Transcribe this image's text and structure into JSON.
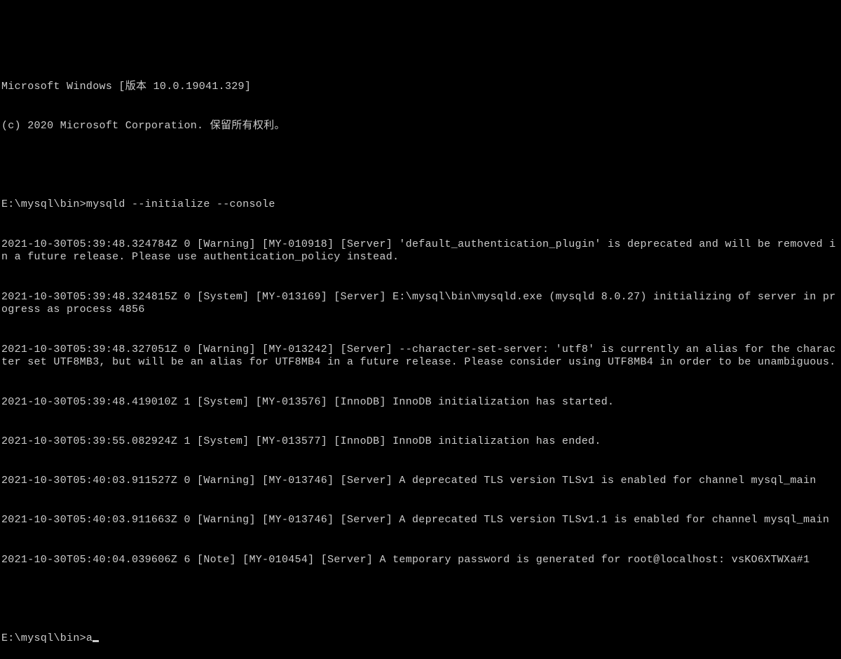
{
  "header": {
    "line1": "Microsoft Windows [版本 10.0.19041.329]",
    "line2": "(c) 2020 Microsoft Corporation. 保留所有权利。"
  },
  "command1": {
    "prompt": "E:\\mysql\\bin>",
    "cmd": "mysqld --initialize --console"
  },
  "output": {
    "l1": "2021-10-30T05:39:48.324784Z 0 [Warning] [MY-010918] [Server] 'default_authentication_plugin' is deprecated and will be removed in a future release. Please use authentication_policy instead.",
    "l2": "2021-10-30T05:39:48.324815Z 0 [System] [MY-013169] [Server] E:\\mysql\\bin\\mysqld.exe (mysqld 8.0.27) initializing of server in progress as process 4856",
    "l3": "2021-10-30T05:39:48.327051Z 0 [Warning] [MY-013242] [Server] --character-set-server: 'utf8' is currently an alias for the character set UTF8MB3, but will be an alias for UTF8MB4 in a future release. Please consider using UTF8MB4 in order to be unambiguous.",
    "l4": "2021-10-30T05:39:48.419010Z 1 [System] [MY-013576] [InnoDB] InnoDB initialization has started.",
    "l5": "2021-10-30T05:39:55.082924Z 1 [System] [MY-013577] [InnoDB] InnoDB initialization has ended.",
    "l6": "2021-10-30T05:40:03.911527Z 0 [Warning] [MY-013746] [Server] A deprecated TLS version TLSv1 is enabled for channel mysql_main",
    "l7": "2021-10-30T05:40:03.911663Z 0 [Warning] [MY-013746] [Server] A deprecated TLS version TLSv1.1 is enabled for channel mysql_main",
    "l8": "2021-10-30T05:40:04.039606Z 6 [Note] [MY-010454] [Server] A temporary password is generated for root@localhost: vsKO6XTWXa#1"
  },
  "prompt2": {
    "prompt": "E:\\mysql\\bin>",
    "typed": "a"
  }
}
